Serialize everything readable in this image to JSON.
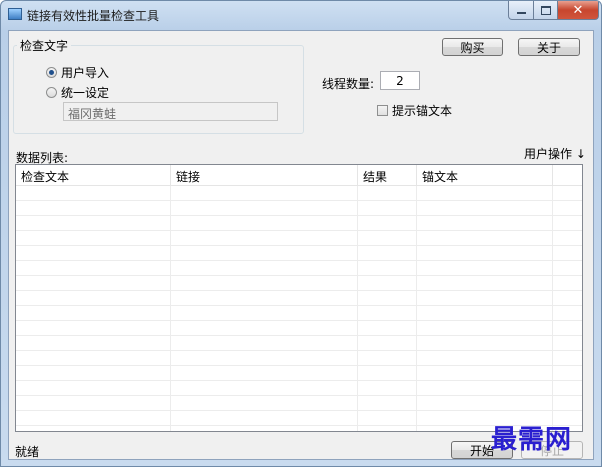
{
  "window": {
    "title": "链接有效性批量检查工具"
  },
  "controls": {
    "close_glyph": "✕"
  },
  "group": {
    "label": "检查文字",
    "options": [
      {
        "label": "用户导入",
        "selected": true
      },
      {
        "label": "统一设定",
        "selected": false
      }
    ],
    "text_value": "福冈黄蛙"
  },
  "buttons": {
    "buy": "购买",
    "about": "关于",
    "start": "开始",
    "stop": "停止"
  },
  "threads": {
    "label": "线程数量:",
    "value": "2"
  },
  "anchor_option": {
    "label": "提示锚文本",
    "checked": false
  },
  "list": {
    "label": "数据列表:",
    "user_action": "用户操作",
    "action_arrow": "↓",
    "columns": [
      "检查文本",
      "链接",
      "结果",
      "锚文本"
    ],
    "rows": []
  },
  "status": {
    "text": "就绪"
  },
  "watermark": "最需网"
}
